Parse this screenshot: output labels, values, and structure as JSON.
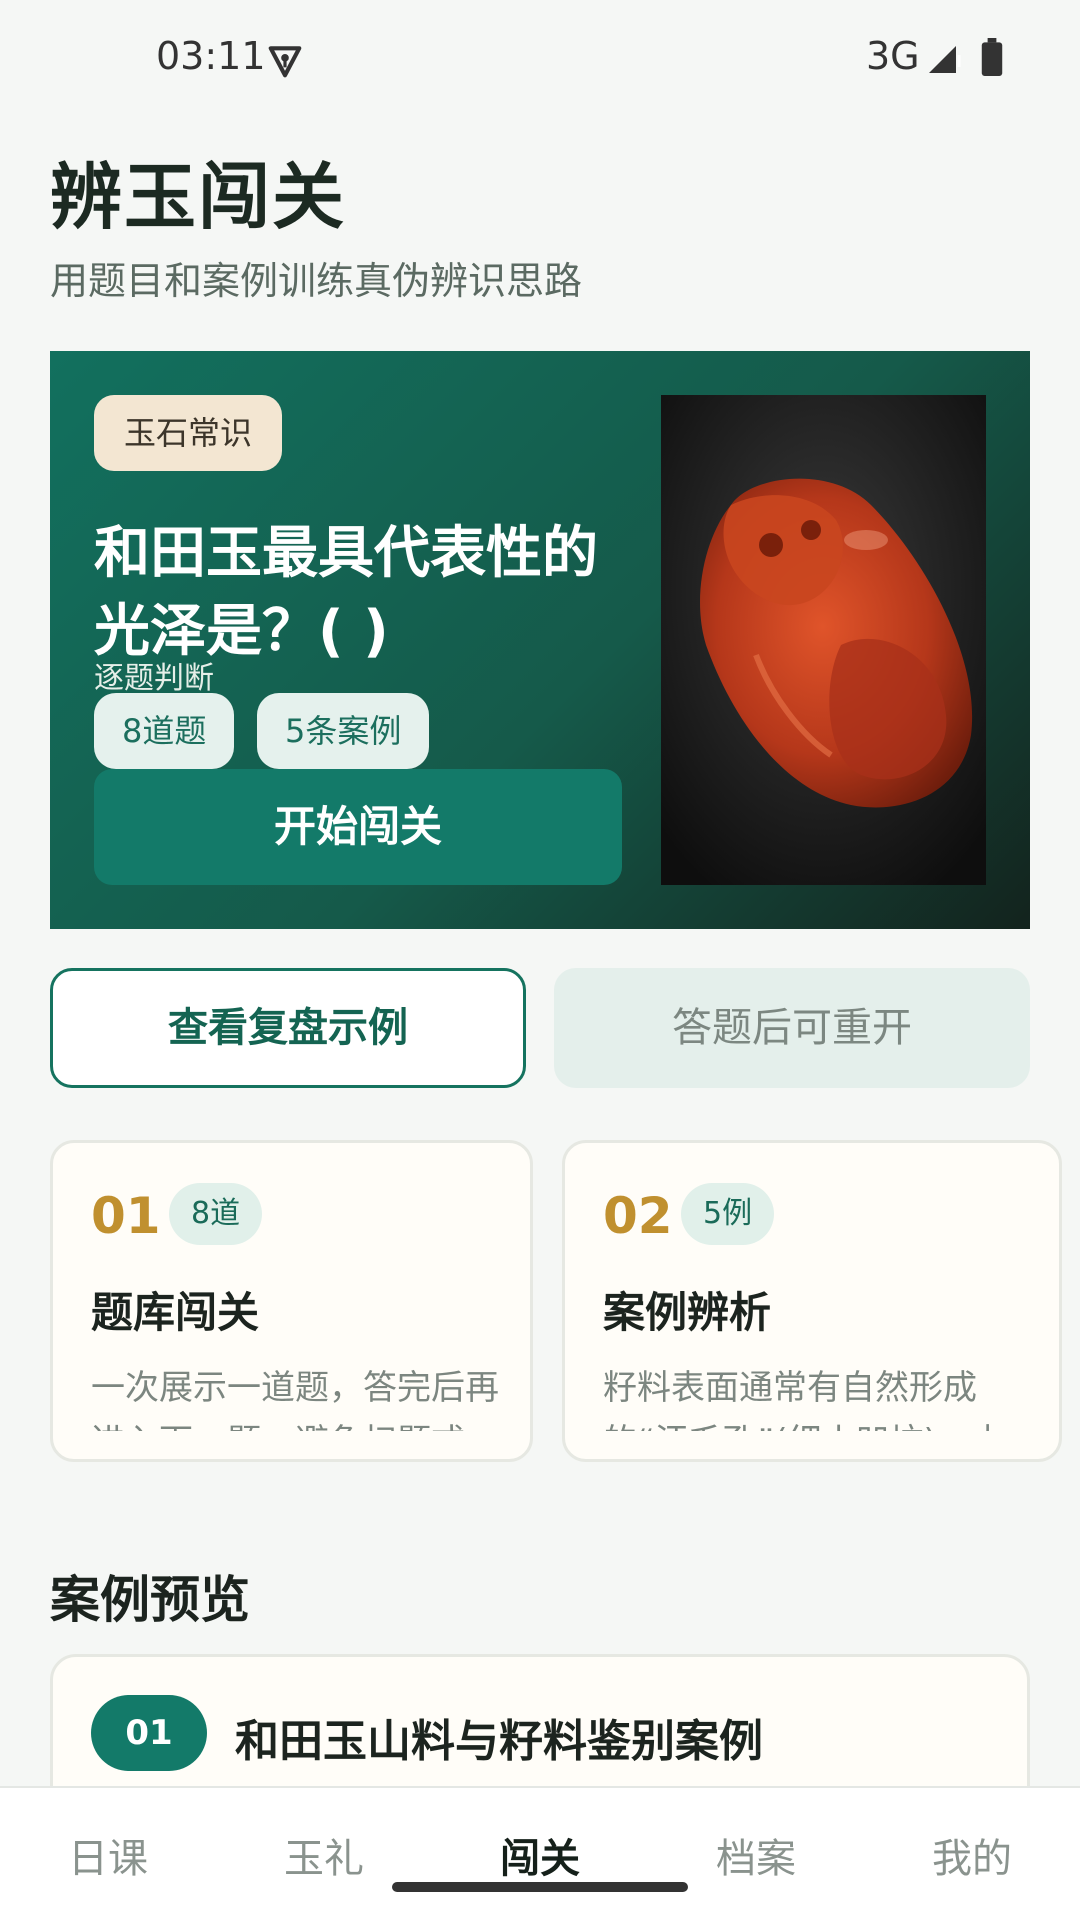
{
  "status_bar": {
    "time": "03:11",
    "network": "3G"
  },
  "header": {
    "title": "辨玉闯关",
    "subtitle": "用题目和案例训练真伪辨识思路"
  },
  "hero": {
    "tag": "玉石常识",
    "question": "和田玉最具代表性的光泽是？( )",
    "hint": "逐题判断",
    "chips": [
      "8道题",
      "5条案例"
    ],
    "start_label": "开始闯关"
  },
  "actions": {
    "review_label": "查看复盘示例",
    "reopen_label": "答题后可重开"
  },
  "modes": [
    {
      "num": "01",
      "badge": "8道",
      "title": "题库闯关",
      "desc": "一次展示一道题，答完后再进入下一题，避免扫题式"
    },
    {
      "num": "02",
      "badge": "5例",
      "title": "案例辨析",
      "desc": "籽料表面通常有自然形成的“汗毛孔”(细小凹坑)，由"
    }
  ],
  "section": {
    "title": "案例预览"
  },
  "case_preview": {
    "num": "01",
    "title": "和田玉山料与籽料鉴别案例"
  },
  "nav": [
    "日课",
    "玉礼",
    "闯关",
    "档案",
    "我的"
  ],
  "colors": {
    "primary": "#137a69",
    "accent_gold": "#c0902f",
    "tag_bg": "#f3e6d2"
  },
  "icons": {
    "vpn": "vpn-key-icon",
    "signal": "cell-signal-icon",
    "battery": "battery-icon"
  }
}
